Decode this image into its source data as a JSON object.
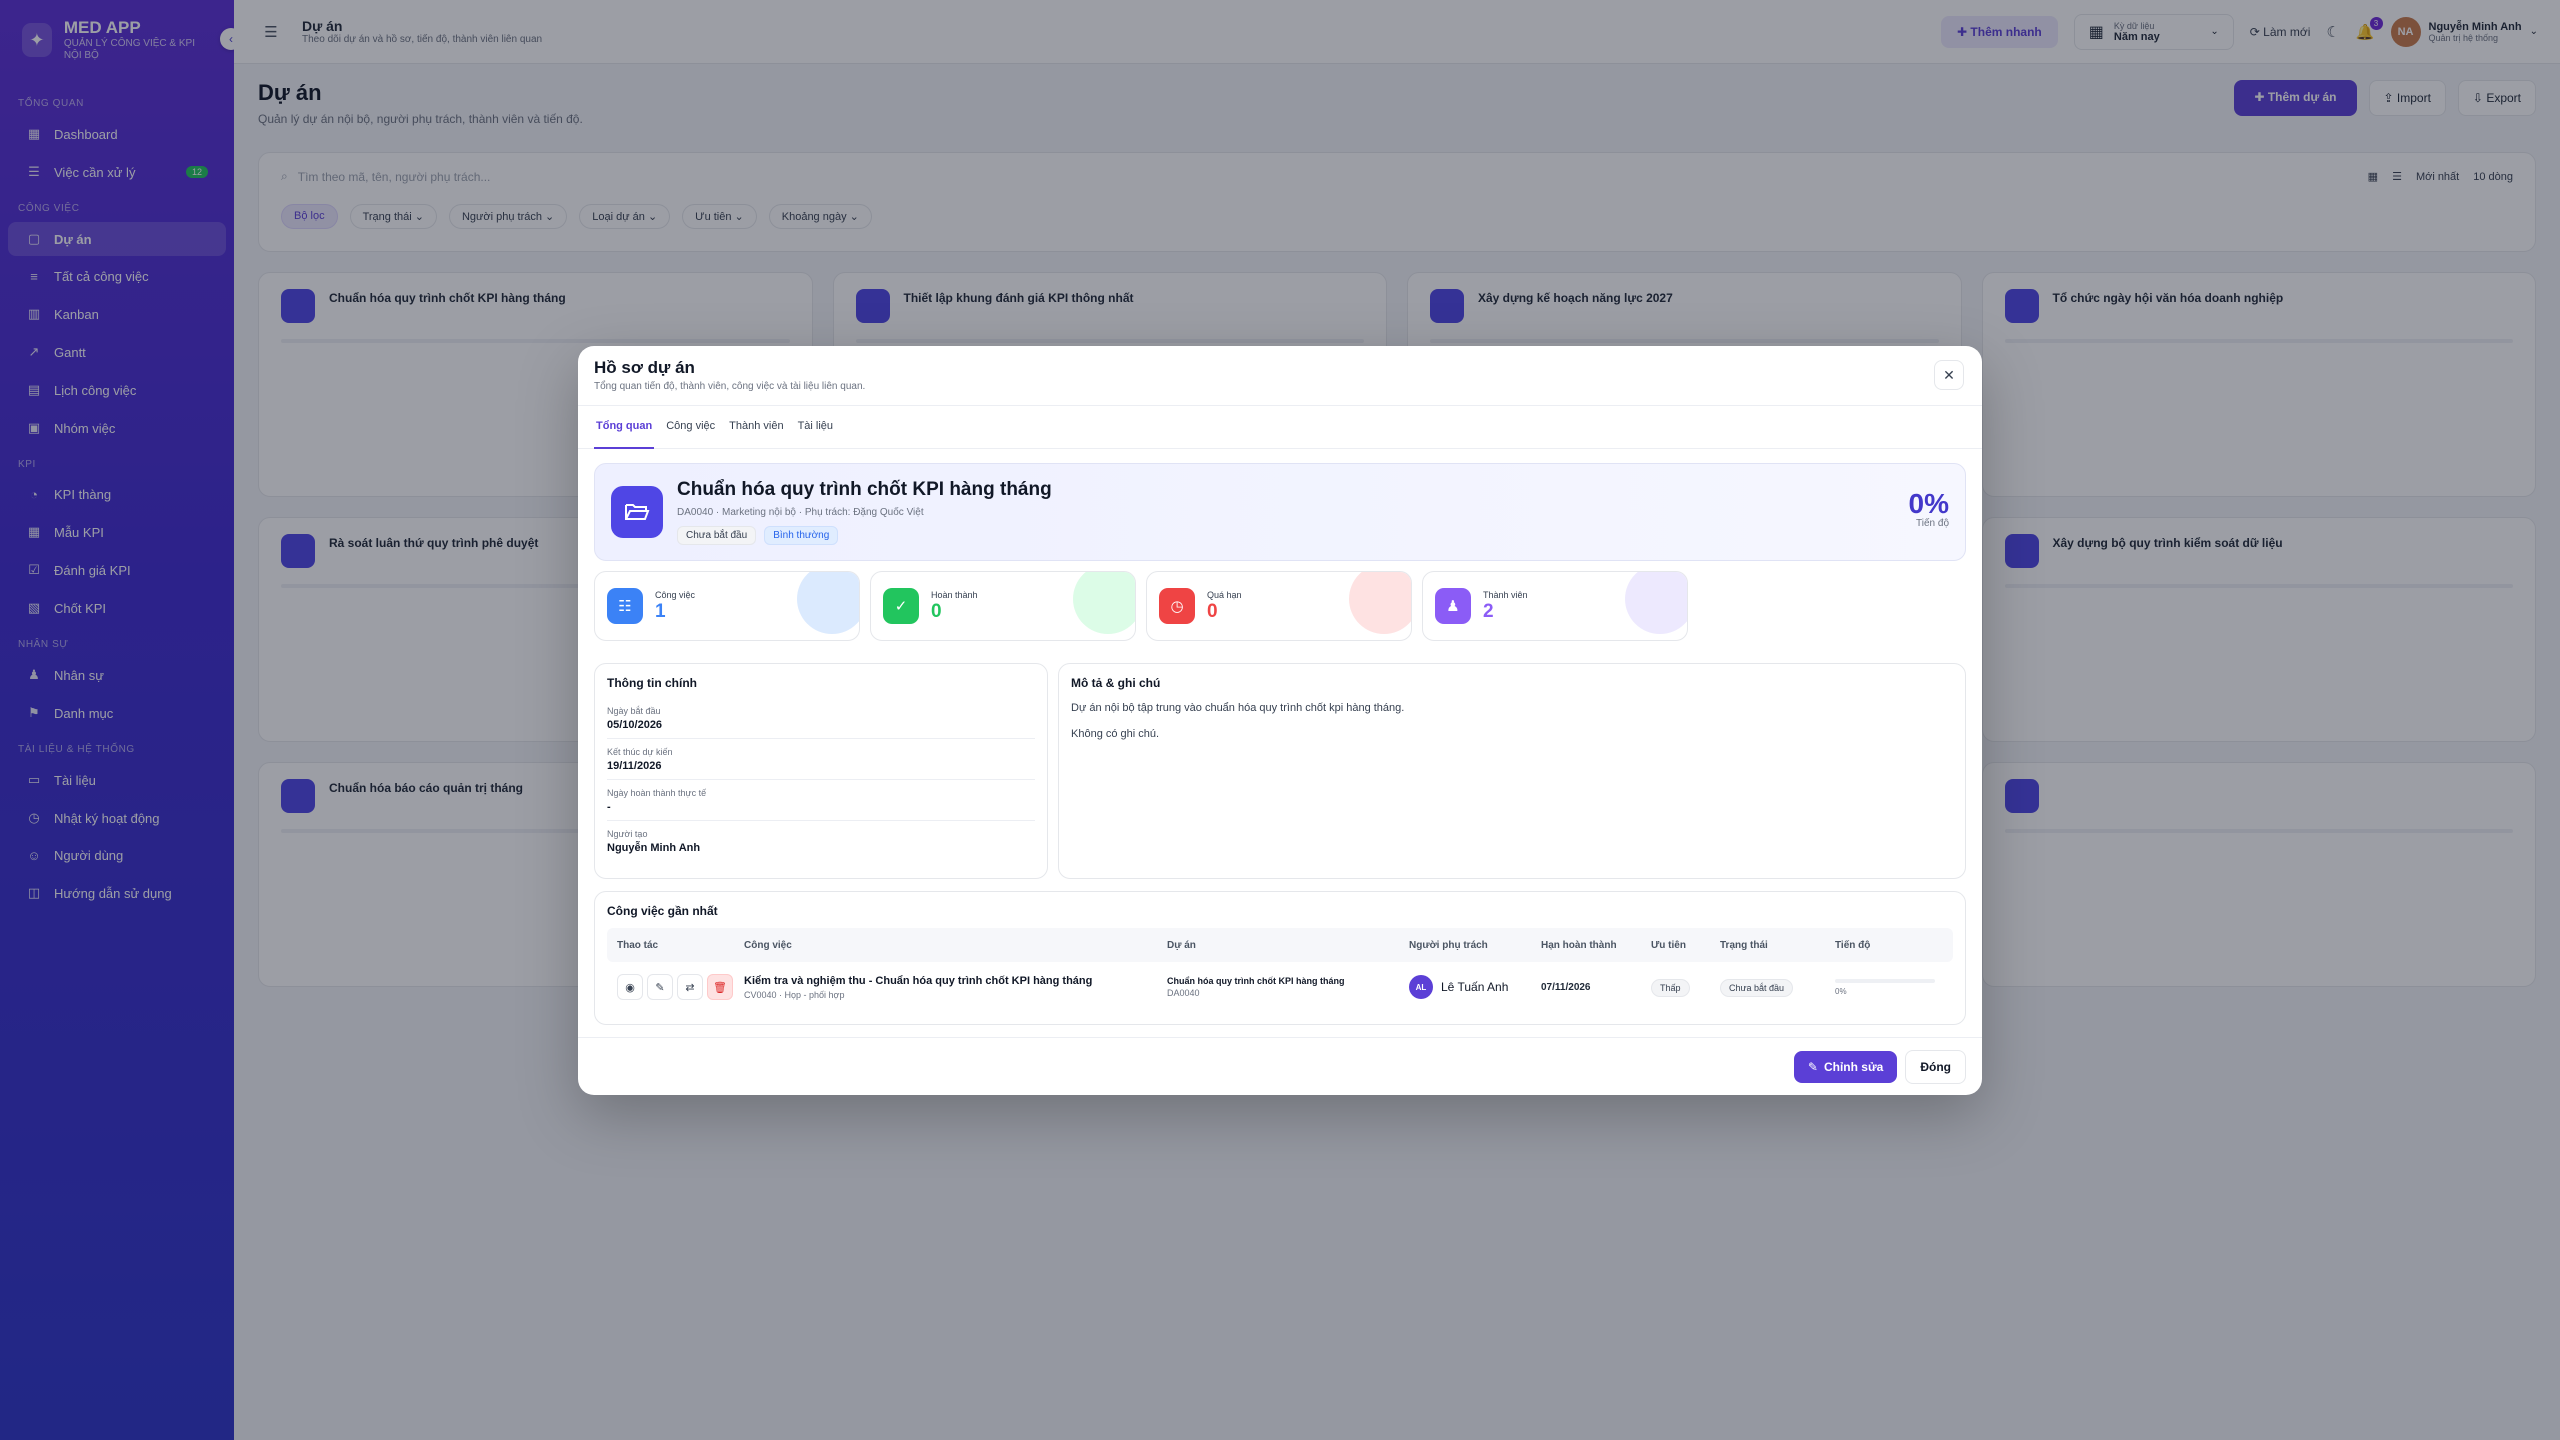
{
  "sidebar": {
    "brand": {
      "name": "MED APP",
      "sub": "QUẢN LÝ CÔNG VIỆC & KPI NỘI BỘ"
    },
    "sections": [
      {
        "label": "TỔNG QUAN",
        "items": [
          {
            "icon": "▦",
            "label": "Dashboard"
          },
          {
            "icon": "☰",
            "label": "Việc cần xử lý",
            "badge": "12"
          }
        ]
      },
      {
        "label": "CÔNG VIỆC",
        "items": [
          {
            "icon": "▢",
            "label": "Dự án",
            "active": true
          },
          {
            "icon": "≡",
            "label": "Tất cả công việc"
          },
          {
            "icon": "▥",
            "label": "Kanban"
          },
          {
            "icon": "↗",
            "label": "Gantt"
          },
          {
            "icon": "▤",
            "label": "Lịch công việc"
          },
          {
            "icon": "▣",
            "label": "Nhóm việc"
          }
        ]
      },
      {
        "label": "KPI",
        "items": [
          {
            "icon": "◔",
            "label": "KPI thàng"
          },
          {
            "icon": "▦",
            "label": "Mẫu KPI"
          },
          {
            "icon": "☑",
            "label": "Đánh giá KPI"
          },
          {
            "icon": "▧",
            "label": "Chốt KPI"
          }
        ]
      },
      {
        "label": "NHÂN SỰ",
        "items": [
          {
            "icon": "♟",
            "label": "Nhân sự"
          },
          {
            "icon": "⚑",
            "label": "Danh mục"
          }
        ]
      },
      {
        "label": "TÀI LIỆU & HỆ THỐNG",
        "items": [
          {
            "icon": "▭",
            "label": "Tài liệu"
          },
          {
            "icon": "◷",
            "label": "Nhật ký hoạt động"
          },
          {
            "icon": "☺",
            "label": "Người dùng"
          },
          {
            "icon": "◫",
            "label": "Hướng dẫn sử dụng"
          }
        ]
      }
    ]
  },
  "topbar": {
    "title": "Dự án",
    "subtitle": "Theo dõi dự án và hồ sơ, tiến độ, thành viên liên quan",
    "quick_add": "Thêm nhanh",
    "period_label": "Kỳ dữ liệu",
    "period_value": "Năm nay",
    "refresh": "Làm mới",
    "notif_count": "3",
    "user_name": "Nguyễn Minh Anh",
    "user_role": "Quản trị hệ thống"
  },
  "page": {
    "title": "Dự án",
    "subtitle": "Quản lý dự án nội bộ, người phụ trách, thành viên và tiến độ.",
    "add_btn": "Thêm dự án",
    "import_btn": "Import",
    "export_btn": "Export",
    "search_placeholder": "Tìm theo mã, tên, người phụ trách...",
    "sort": "Mới nhất",
    "per_page": "10 dòng",
    "chips": [
      "Bộ lọc",
      "Trạng thái",
      "Người phụ trách",
      "Loại dự án",
      "Ưu tiên",
      "Khoảng ngày"
    ],
    "card_titles": [
      "Chuẩn hóa quy trình chốt KPI hàng tháng",
      "Thiết lập khung đánh giá KPI thông nhất",
      "Xây dựng kế hoạch năng lực 2027",
      "Tổ chức ngày hội văn hóa doanh nghiệp",
      "Rà soát luân thứ quy trình phê duyệt",
      "",
      "",
      "Xây dựng bộ quy trình kiểm soát dữ liệu",
      "Chuẩn hóa báo cáo quản trị tháng",
      "",
      "",
      ""
    ]
  },
  "modal": {
    "title": "Hồ sơ dự án",
    "subtitle": "Tổng quan tiến độ, thành viên, công việc và tài liệu liên quan.",
    "tabs": [
      "Tổng quan",
      "Công việc",
      "Thành viên",
      "Tài liệu"
    ],
    "hero": {
      "title": "Chuẩn hóa quy trình chốt KPI hàng tháng",
      "meta": "DA0040 · Marketing nội bộ · Phụ trách: Đặng Quốc Việt",
      "tag_status": "Chưa bắt đầu",
      "tag_priority": "Bình thường",
      "progress": "0%",
      "progress_label": "Tiến độ"
    },
    "stats": [
      {
        "label": "Công việc",
        "value": "1",
        "color": "#3b82f6",
        "bubble": "#dbeafe",
        "icon": "☷"
      },
      {
        "label": "Hoàn thành",
        "value": "0",
        "color": "#22c55e",
        "bubble": "#dcfce7",
        "icon": "✓"
      },
      {
        "label": "Quá hạn",
        "value": "0",
        "color": "#ef4444",
        "bubble": "#fee2e2",
        "icon": "◷"
      },
      {
        "label": "Thành viên",
        "value": "2",
        "color": "#8b5cf6",
        "bubble": "#ede9fe",
        "icon": "♟"
      }
    ],
    "info": {
      "title": "Thông tin chính",
      "items": [
        {
          "label": "Ngày bắt đầu",
          "value": "05/10/2026"
        },
        {
          "label": "Kết thúc dự kiến",
          "value": "19/11/2026"
        },
        {
          "label": "Ngày hoàn thành thực tế",
          "value": "-"
        },
        {
          "label": "Người tạo",
          "value": "Nguyễn Minh Anh"
        }
      ]
    },
    "desc": {
      "title": "Mô tả & ghi chú",
      "text": "Dự án nội bộ tập trung vào chuẩn hóa quy trình chốt kpi hàng tháng.",
      "note": "Không có ghi chú."
    },
    "tasks": {
      "title": "Công việc gần nhất",
      "columns": [
        "Thao tác",
        "Công việc",
        "Dự án",
        "Người phụ trách",
        "Hạn hoàn thành",
        "Ưu tiên",
        "Trạng thái",
        "Tiến độ"
      ],
      "rows": [
        {
          "name": "Kiểm tra và nghiệm thu - Chuẩn hóa quy trình chốt KPI hàng tháng",
          "sub": "CV0040 · Họp - phối hợp",
          "project": "Chuẩn hóa quy trình chốt KPI hàng tháng",
          "project_code": "DA0040",
          "owner_initials": "AL",
          "owner": "Lê Tuấn Anh",
          "due": "07/11/2026",
          "priority": "Thấp",
          "status": "Chưa bắt đầu",
          "progress": "0%",
          "progress_value": 0
        }
      ]
    },
    "edit_btn": "Chỉnh sửa",
    "close_btn": "Đóng"
  }
}
